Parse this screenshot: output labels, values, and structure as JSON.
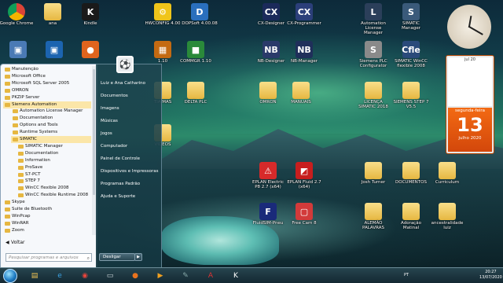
{
  "desktop": {
    "icons": [
      {
        "id": "chrome",
        "label": "Google Chrome",
        "glyph": "◉",
        "kind": "app",
        "color": "#ffffff"
      },
      {
        "id": "ana",
        "label": "ana",
        "glyph": "",
        "kind": "folder"
      },
      {
        "id": "kindle",
        "label": "Kindle",
        "glyph": "K",
        "kind": "app",
        "color": "#1a1a1a"
      },
      {
        "id": "hwconfig",
        "label": "HWCONFIG 4.00",
        "glyph": "⚙",
        "kind": "app",
        "color": "#f0c51a"
      },
      {
        "id": "dopsoft",
        "label": "DOPSoft 4.00.08",
        "glyph": "D",
        "kind": "app",
        "color": "#2a6fbd"
      },
      {
        "id": "cxdesigner",
        "label": "CX-Designer",
        "glyph": "CX",
        "kind": "app",
        "color": "#1b2a5a"
      },
      {
        "id": "cxprogrammer",
        "label": "CX-Programmer",
        "glyph": "CX",
        "kind": "app",
        "color": "#2b3f7a"
      },
      {
        "id": "licensemanager",
        "label": "Automation License Manager",
        "glyph": "L",
        "kind": "app",
        "color": "#2b3f5a"
      },
      {
        "id": "simaticmanager",
        "label": "SIMATIC Manager",
        "glyph": "S",
        "kind": "app",
        "color": "#3a5a7a"
      },
      {
        "id": "computer",
        "label": "",
        "glyph": "▣",
        "kind": "app",
        "color": "#4a7ab5"
      },
      {
        "id": "rcp",
        "label": "",
        "glyph": "▣",
        "kind": "app",
        "color": "#1c64b0"
      },
      {
        "id": "firefox",
        "label": "",
        "glyph": "●",
        "kind": "app",
        "color": "#e0641e"
      },
      {
        "id": "app110",
        "label": "1.10",
        "glyph": "▦",
        "kind": "app",
        "color": "#c46a12"
      },
      {
        "id": "commgr",
        "label": "COMMGR 1.10",
        "glyph": "■",
        "kind": "app",
        "color": "#2a8a3a"
      },
      {
        "id": "nbdesigner",
        "label": "NB-Designer",
        "glyph": "NB",
        "kind": "app",
        "color": "#2a3a6a"
      },
      {
        "id": "nbmanager",
        "label": "NB-Manager",
        "glyph": "NB",
        "kind": "app",
        "color": "#1f2f5a"
      },
      {
        "id": "siemensplc",
        "label": "Siemens PLC Configurator",
        "glyph": "S",
        "kind": "app",
        "color": "#8a8a8a"
      },
      {
        "id": "wincc",
        "label": "SIMATIC WinCC flexible 2008",
        "glyph": "Cfle",
        "kind": "app",
        "color": "#2a4a7a"
      },
      {
        "id": "deltaplc",
        "label": "DELTA PLC",
        "glyph": "",
        "kind": "folder"
      },
      {
        "id": "omron",
        "label": "OMRON",
        "glyph": "",
        "kind": "folder"
      },
      {
        "id": "manuais",
        "label": "MANUAIS",
        "glyph": "",
        "kind": "folder"
      },
      {
        "id": "licenca",
        "label": "LICENÇA SIMATIC 2018",
        "glyph": "",
        "kind": "folder"
      },
      {
        "id": "siemensstep",
        "label": "SIEMENS STEP 7 V5.5",
        "glyph": "",
        "kind": "folder"
      },
      {
        "id": "tiamas",
        "label": "TIA MAS",
        "glyph": "",
        "kind": "folder"
      },
      {
        "id": "videos",
        "label": "VIDEOS",
        "glyph": "",
        "kind": "folder"
      },
      {
        "id": "epluntetrol",
        "label": "EPLAN Electric P8 2.7 (x64)",
        "glyph": "⚠",
        "kind": "app",
        "color": "#d72a2a"
      },
      {
        "id": "eplanfluid",
        "label": "EPLAN Fluid 2.7 (x64)",
        "glyph": "◩",
        "kind": "app",
        "color": "#c81e1e"
      },
      {
        "id": "fluidsim",
        "label": "FluidSIM-Pneu",
        "glyph": "F",
        "kind": "app",
        "color": "#1a2a7a"
      },
      {
        "id": "freecam",
        "label": "Free Cam 8",
        "glyph": "▢",
        "kind": "app",
        "color": "#d23a3a"
      },
      {
        "id": "joshturner",
        "label": "Josh Turner",
        "glyph": "",
        "kind": "folder"
      },
      {
        "id": "documentos",
        "label": "DOCUMENTOS",
        "glyph": "",
        "kind": "folder"
      },
      {
        "id": "curriculum",
        "label": "Curriculum",
        "glyph": "",
        "kind": "folder"
      },
      {
        "id": "alemao",
        "label": "ALEMÃO PALAVRAS",
        "glyph": "",
        "kind": "folder"
      },
      {
        "id": "adoracao",
        "label": "Adoração Matinal",
        "glyph": "",
        "kind": "folder"
      },
      {
        "id": "ancestralidade",
        "label": "ancestralidade luiz",
        "glyph": "",
        "kind": "folder"
      }
    ]
  },
  "start_menu": {
    "programs": [
      {
        "label": "Manutenção",
        "level": 0,
        "hl": false
      },
      {
        "label": "Microsoft Office",
        "level": 0,
        "hl": false
      },
      {
        "label": "Microsoft SQL Server 2005",
        "level": 0,
        "hl": false
      },
      {
        "label": "OMRON",
        "level": 0,
        "hl": false
      },
      {
        "label": "PKZIP Server",
        "level": 0,
        "hl": false
      },
      {
        "label": "Siemens Automation",
        "level": 0,
        "hl": true
      },
      {
        "label": "Automation License Manager",
        "level": 1,
        "hl": false
      },
      {
        "label": "Documentation",
        "level": 1,
        "hl": false
      },
      {
        "label": "Options and Tools",
        "level": 1,
        "hl": false
      },
      {
        "label": "Runtime Systems",
        "level": 1,
        "hl": false
      },
      {
        "label": "SIMATIC",
        "level": 1,
        "hl": true
      },
      {
        "label": "SIMATIC Manager",
        "level": 2,
        "hl": false
      },
      {
        "label": "Documentation",
        "level": 2,
        "hl": false
      },
      {
        "label": "Information",
        "level": 2,
        "hl": false
      },
      {
        "label": "ProSave",
        "level": 2,
        "hl": false
      },
      {
        "label": "S7-PCT",
        "level": 2,
        "hl": false
      },
      {
        "label": "STEP 7",
        "level": 2,
        "hl": false
      },
      {
        "label": "WinCC flexible 2008",
        "level": 2,
        "hl": false
      },
      {
        "label": "WinCC flexible Runtime 2008",
        "level": 2,
        "hl": false
      },
      {
        "label": "Skype",
        "level": 0,
        "hl": false
      },
      {
        "label": "Suite de Bluetooth",
        "level": 0,
        "hl": false
      },
      {
        "label": "WinPcap",
        "level": 0,
        "hl": false
      },
      {
        "label": "WinRAR",
        "level": 0,
        "hl": false
      },
      {
        "label": "Zoom",
        "level": 0,
        "hl": false
      }
    ],
    "back_label": "Voltar",
    "search_placeholder": "Pesquisar programas e arquivos",
    "right_links": [
      "Luiz e Ana Catharino",
      "Documentos",
      "Imagens",
      "Músicas",
      "Jogos",
      "Computador",
      "Painel de Controle",
      "Dispositivos e Impressoras",
      "Programas Padrão",
      "Ajuda e Suporte"
    ],
    "shutdown_label": "Desligar"
  },
  "calendar": {
    "month_year": "julho de 2020",
    "mini_header": "jul 20",
    "weekday": "segunda-feira",
    "day": "13",
    "month": "julho 2020"
  },
  "taskbar": {
    "language": "PT",
    "time": "20:27",
    "date": "13/07/2020",
    "buttons": [
      "explorer",
      "ie",
      "chrome",
      "notes",
      "firefox",
      "media",
      "tools",
      "acrobat",
      "kindle-reader"
    ]
  }
}
